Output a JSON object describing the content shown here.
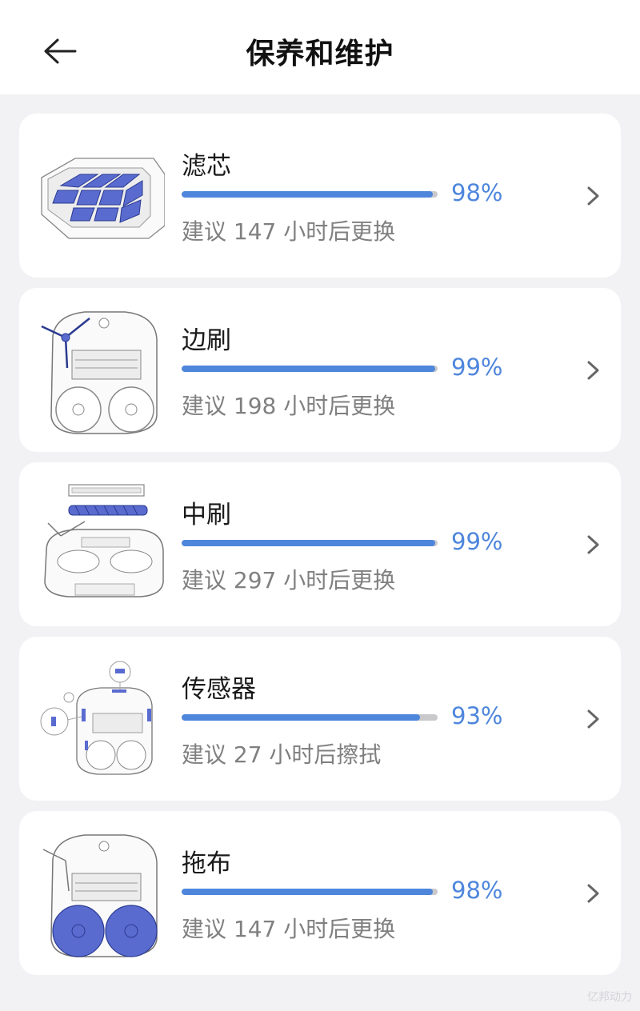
{
  "header": {
    "title": "保养和维护"
  },
  "items": [
    {
      "name": "滤芯",
      "percent_text": "98%",
      "percent": 98,
      "hint": "建议 147 小时后更换",
      "thumb": "filter-icon"
    },
    {
      "name": "边刷",
      "percent_text": "99%",
      "percent": 99,
      "hint": "建议 198 小时后更换",
      "thumb": "side-brush-icon"
    },
    {
      "name": "中刷",
      "percent_text": "99%",
      "percent": 99,
      "hint": "建议 297 小时后更换",
      "thumb": "main-brush-icon"
    },
    {
      "name": "传感器",
      "percent_text": "93%",
      "percent": 93,
      "hint": "建议 27 小时后擦拭",
      "thumb": "sensor-icon"
    },
    {
      "name": "拖布",
      "percent_text": "98%",
      "percent": 98,
      "hint": "建议 147 小时后更换",
      "thumb": "mop-icon"
    }
  ],
  "colors": {
    "accent": "#4e86dc",
    "track": "#c9c9cc",
    "background": "#f2f2f4"
  },
  "watermark": "亿邦动力"
}
